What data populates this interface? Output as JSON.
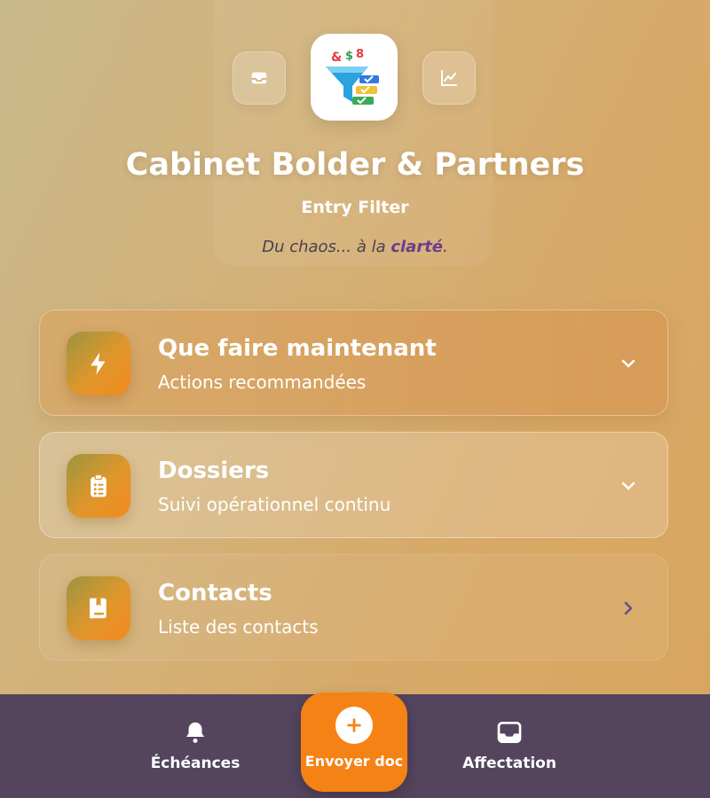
{
  "header": {
    "title": "Cabinet Bolder & Partners",
    "subtitle": "Entry Filter",
    "tagline_prefix": "Du chaos... à la",
    "tagline_accent": "clarté",
    "tagline_suffix": "."
  },
  "header_buttons": {
    "left_icon": "inbox-icon",
    "right_icon": "chart-line-icon",
    "logo_icon": "funnel-logo-icon"
  },
  "cards": [
    {
      "title": "Que faire maintenant",
      "subtitle": "Actions recommandées",
      "icon": "lightning-icon",
      "action_icon": "chevron-down-icon"
    },
    {
      "title": "Dossiers",
      "subtitle": "Suivi opérationnel continu",
      "icon": "clipboard-list-icon",
      "action_icon": "chevron-down-icon"
    },
    {
      "title": "Contacts",
      "subtitle": "Liste des contacts",
      "icon": "address-book-icon",
      "action_icon": "chevron-right-icon"
    }
  ],
  "bottom_nav": {
    "left": {
      "label": "Échéances",
      "icon": "bell-icon"
    },
    "center": {
      "label": "Envoyer doc",
      "icon": "plus-circle-icon"
    },
    "right": {
      "label": "Affectation",
      "icon": "inbox-tray-icon"
    }
  },
  "colors": {
    "accent_orange": "#f58214",
    "bottom_bar": "#54445e",
    "tagline_accent": "#6a3d8c"
  }
}
